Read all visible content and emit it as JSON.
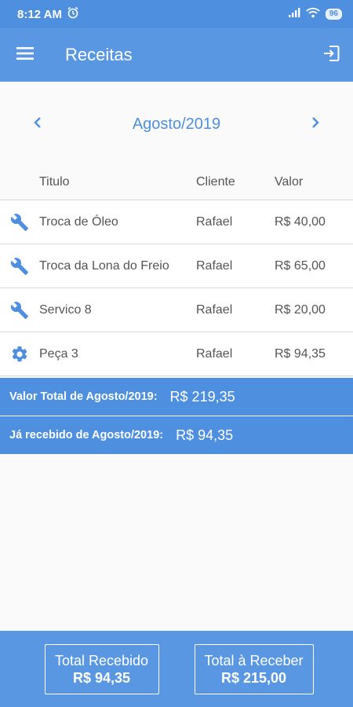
{
  "status_bar": {
    "time": "8:12 AM",
    "battery": "96"
  },
  "app_bar": {
    "title": "Receitas"
  },
  "month_nav": {
    "label": "Agosto/2019"
  },
  "table": {
    "headers": {
      "title": "Titulo",
      "client": "Cliente",
      "value": "Valor"
    },
    "rows": [
      {
        "icon": "wrench-icon",
        "title": "Troca de Óleo",
        "client": "Rafael",
        "value": "R$ 40,00"
      },
      {
        "icon": "wrench-icon",
        "title": "Troca da Lona do Freio",
        "client": "Rafael",
        "value": "R$ 65,00"
      },
      {
        "icon": "wrench-icon",
        "title": "Servico 8",
        "client": "Rafael",
        "value": "R$ 20,00"
      },
      {
        "icon": "gear-icon",
        "title": "Peça 3",
        "client": "Rafael",
        "value": "R$ 94,35"
      }
    ]
  },
  "summary": {
    "total_label": "Valor Total de Agosto/2019:",
    "total_value": "R$ 219,35",
    "received_label": "Já recebido de Agosto/2019:",
    "received_value": "R$ 94,35"
  },
  "bottom": {
    "received_title": "Total Recebido",
    "received_value": "R$ 94,35",
    "to_receive_title": "Total à Receber",
    "to_receive_value": "R$ 215,00"
  },
  "colors": {
    "primary": "#5a97e3",
    "status_bar": "#4f8fe0",
    "text": "#555555"
  }
}
